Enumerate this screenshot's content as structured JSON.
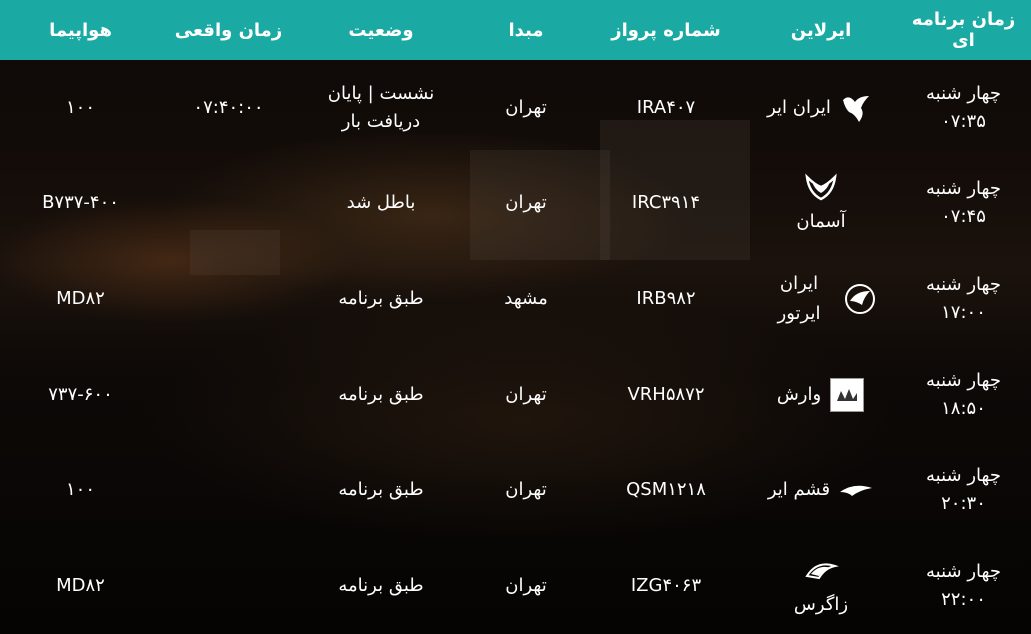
{
  "headers": {
    "scheduled": "زمان برنامه ای",
    "airline": "ایرلاین",
    "flight_number": "شماره پرواز",
    "origin": "مبدا",
    "status": "وضعیت",
    "actual_time": "زمان واقعی",
    "aircraft": "هواپیما"
  },
  "flights": [
    {
      "scheduled": "چهار شنبه ۰۷:۳۵",
      "airline": "ایران ایر",
      "logo_icon": "iran-air-homa-icon",
      "flight_number": "IRA۴۰۷",
      "origin": "تهران",
      "status": "نشست | پایان دریافت بار",
      "actual_time": "۰۷:۴۰:۰۰",
      "aircraft": "۱۰۰"
    },
    {
      "scheduled": "چهار شنبه ۰۷:۴۵",
      "airline": "آسمان",
      "logo_icon": "aseman-wings-icon",
      "flight_number": "IRC۳۹۱۴",
      "origin": "تهران",
      "status": "باطل شد",
      "actual_time": "",
      "aircraft": "B۷۳۷-۴۰۰"
    },
    {
      "scheduled": "چهار شنبه ۱۷:۰۰",
      "airline": "ایران ایرتور",
      "logo_icon": "iran-airtour-icon",
      "flight_number": "IRB۹۸۲",
      "origin": "مشهد",
      "status": "طبق برنامه",
      "actual_time": "",
      "aircraft": "MD۸۲"
    },
    {
      "scheduled": "چهار شنبه ۱۸:۵۰",
      "airline": "وارش",
      "logo_icon": "varesh-box-icon",
      "flight_number": "VRH۵۸۷۲",
      "origin": "تهران",
      "status": "طبق برنامه",
      "actual_time": "",
      "aircraft": "۷۳۷-۶۰۰"
    },
    {
      "scheduled": "چهار شنبه ۲۰:۳۰",
      "airline": "قشم ایر",
      "logo_icon": "qeshm-air-icon",
      "flight_number": "QSM۱۲۱۸",
      "origin": "تهران",
      "status": "طبق برنامه",
      "actual_time": "",
      "aircraft": "۱۰۰"
    },
    {
      "scheduled": "چهار شنبه ۲۲:۰۰",
      "airline": "زاگرس",
      "logo_icon": "zagros-icon",
      "flight_number": "IZG۴۰۶۳",
      "origin": "تهران",
      "status": "طبق برنامه",
      "actual_time": "",
      "aircraft": "MD۸۲"
    }
  ],
  "colors": {
    "header_bg": "#1aa9a3",
    "text": "#ffffff"
  }
}
